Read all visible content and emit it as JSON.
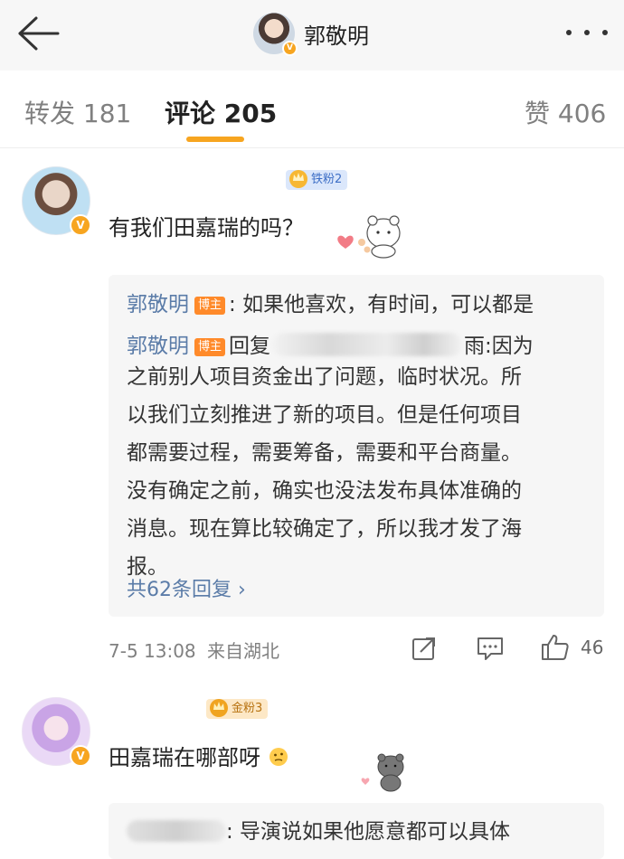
{
  "header": {
    "title": "郭敬明",
    "avatar_badge": "V",
    "back_icon": "arrow-left-icon",
    "more_icon": "more-dots-icon"
  },
  "tabs": [
    {
      "label": "转发 181"
    },
    {
      "label": "评论 205",
      "active": true
    },
    {
      "label": "赞 406"
    }
  ],
  "colors": {
    "accent": "#f7a520",
    "link_blue": "#5b7ca8",
    "blogger_tag": "#ff8a2a",
    "reply_bg": "#f6f6f6"
  },
  "comments": [
    {
      "fan_badge": "铁粉2",
      "avatar_badge": "V",
      "text": "有我们田嘉瑞的吗？",
      "replies": [
        {
          "user": "郭敬明",
          "tag": "博主",
          "text": ": 如果他喜欢，有时间，可以都是"
        },
        {
          "user": "郭敬明",
          "tag": "博主",
          "prefix": "回复",
          "suffix": "雨:因为"
        }
      ],
      "reply_lines": [
        "之前别人项目资金出了问题，临时状况。所",
        "以我们立刻推进了新的项目。但是任何项目",
        "都需要过程，需要筹备，需要和平台商量。",
        "没有确定之前，确实也没法发布具体准确的",
        "消息。现在算比较确定了，所以我才发了海",
        "报。"
      ],
      "more_replies": "共62条回复 ",
      "more_chevron": "›",
      "timestamp": "7-5 13:08",
      "location": "来自湖北",
      "like_count": "46"
    },
    {
      "fan_badge": "金粉3",
      "avatar_badge": "V",
      "text": "田嘉瑞在哪部呀",
      "reply_partial": ": 导演说如果他愿意都可以具体"
    }
  ]
}
